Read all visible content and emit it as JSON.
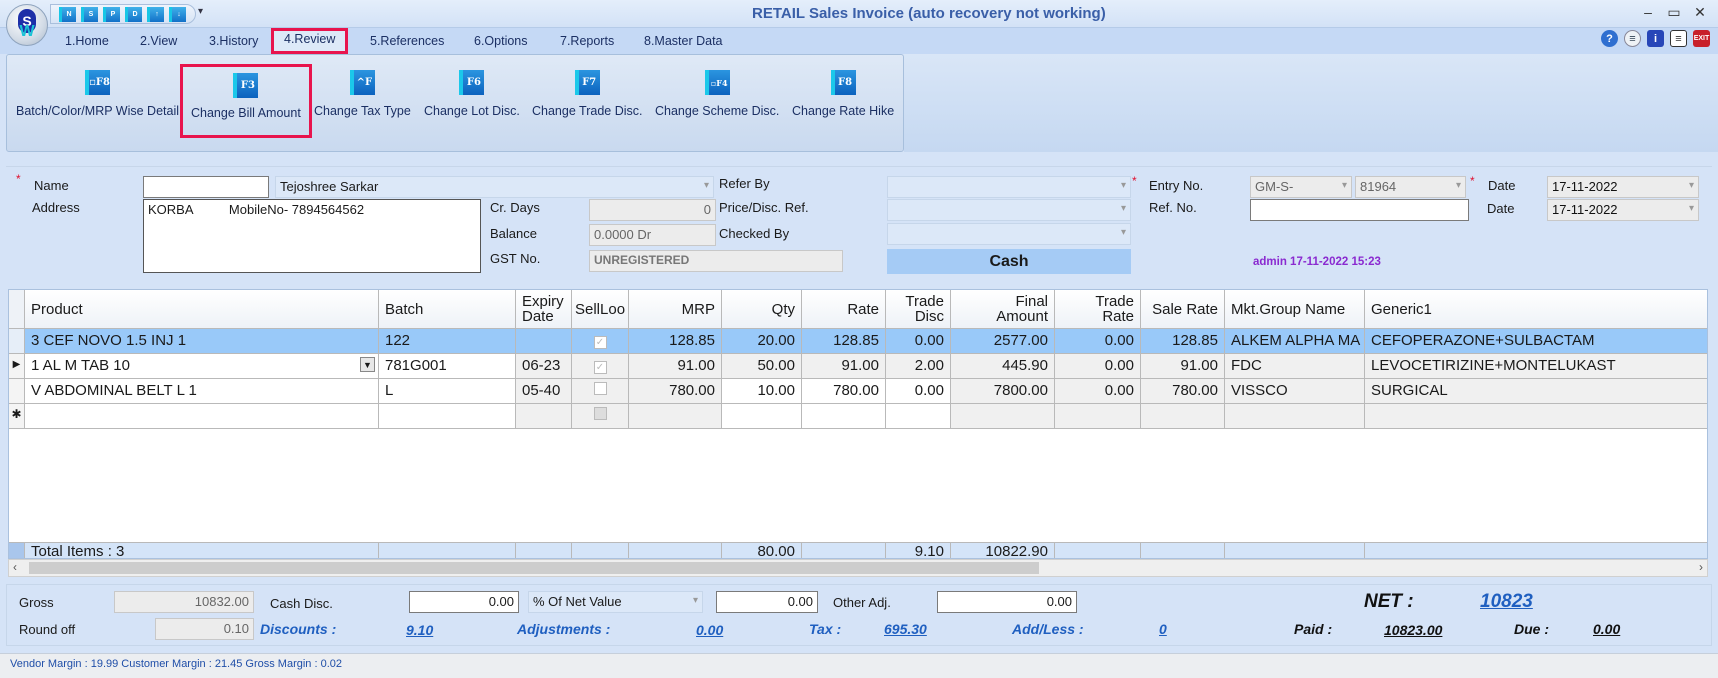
{
  "window": {
    "title": "RETAIL Sales Invoice (auto recovery not working)",
    "controls": {
      "minimize": "–",
      "maximize": "▭",
      "close": "✕"
    }
  },
  "quick_access": [
    {
      "label": "N",
      "icon": "new-icon"
    },
    {
      "label": "S",
      "icon": "save-icon"
    },
    {
      "label": "P",
      "icon": "print-icon"
    },
    {
      "label": "D",
      "icon": "delete-icon"
    },
    {
      "label": "↑",
      "icon": "previous-icon"
    },
    {
      "label": "↓",
      "icon": "next-icon"
    }
  ],
  "menu": {
    "tabs": [
      "1.Home",
      "2.View",
      "3.History",
      "4.Review",
      "5.References",
      "6.Options",
      "7.Reports",
      "8.Master Data"
    ],
    "active": "4.Review"
  },
  "help_icons": [
    "help-icon",
    "chat-icon",
    "info-icon",
    "document-icon",
    "exit-icon"
  ],
  "ribbon": {
    "buttons": [
      {
        "label": "Batch/Color/MRP Wise Detail",
        "key": "▫F8"
      },
      {
        "label": "Change Bill Amount",
        "key": "F3",
        "highlighted": true
      },
      {
        "label": "Change Tax Type",
        "key": "^F"
      },
      {
        "label": "Change Lot Disc.",
        "key": "F6"
      },
      {
        "label": "Change Trade Disc.",
        "key": "F7"
      },
      {
        "label": "Change Scheme Disc.",
        "key": "▫F4"
      },
      {
        "label": "Change Rate Hike",
        "key": "F8"
      }
    ]
  },
  "form": {
    "name_label": "Name",
    "name_code": "",
    "name_value": "Tejoshree Sarkar",
    "address_label": "Address",
    "address_value": "KORBA          MobileNo- 7894564562",
    "cr_days_label": "Cr. Days",
    "cr_days_value": "0",
    "balance_label": "Balance",
    "balance_value": "0.0000 Dr",
    "gst_label": "GST No.",
    "gst_value": "UNREGISTERED",
    "refer_by_label": "Refer By",
    "refer_by_value": "",
    "price_disc_label": "Price/Disc. Ref.",
    "price_disc_value": "",
    "checked_by_label": "Checked By",
    "checked_by_value": "",
    "payment_mode": "Cash",
    "entry_no_label": "Entry No.",
    "entry_series": "GM-S-",
    "entry_no": "81964",
    "ref_no_label": "Ref. No.",
    "ref_no_value": "",
    "date_label": "Date",
    "date_value": "17-11-2022",
    "ref_date_label": "Date",
    "ref_date_value": "17-11-2022",
    "admin_stamp": "admin 17-11-2022 15:23",
    "required_mark": "*"
  },
  "grid": {
    "columns": [
      "Product",
      "Batch",
      "Expiry Date",
      "SellLoo",
      "MRP",
      "Qty",
      "Rate",
      "Trade Disc",
      "Final Amount",
      "Trade Rate",
      "Sale Rate",
      "Mkt.Group Name",
      "Generic1"
    ],
    "rows": [
      {
        "indicator": "",
        "product": "3 CEF NOVO 1.5 INJ 1",
        "batch": "122",
        "expiry": "",
        "sell_loose": true,
        "mrp": "128.85",
        "qty": "20.00",
        "rate": "128.85",
        "trade_disc": "0.00",
        "final_amount": "2577.00",
        "trade_rate": "0.00",
        "sale_rate": "128.85",
        "mkt_group": "ALKEM ALPHA MA",
        "generic": "CEFOPERAZONE+SULBACTAM"
      },
      {
        "indicator": "▶",
        "product": "1 AL M TAB 10",
        "batch": "781G001",
        "expiry": "06-23",
        "sell_loose": true,
        "mrp": "91.00",
        "qty": "50.00",
        "rate": "91.00",
        "trade_disc": "2.00",
        "final_amount": "445.90",
        "trade_rate": "0.00",
        "sale_rate": "91.00",
        "mkt_group": "FDC",
        "generic": "LEVOCETIRIZINE+MONTELUKAST"
      },
      {
        "indicator": "",
        "product": "V ABDOMINAL BELT L 1",
        "batch": "L",
        "expiry": "05-40",
        "sell_loose": false,
        "mrp": "780.00",
        "qty": "10.00",
        "rate": "780.00",
        "trade_disc": "0.00",
        "final_amount": "7800.00",
        "trade_rate": "0.00",
        "sale_rate": "780.00",
        "mkt_group": "VISSCO",
        "generic": "SURGICAL"
      }
    ],
    "new_row_indicator": "✱",
    "totals": {
      "label": "Total Items : 3",
      "qty": "80.00",
      "trade_disc": "9.10",
      "final_amount": "10822.90"
    }
  },
  "footer": {
    "gross_label": "Gross",
    "gross_value": "10832.00",
    "round_off_label": "Round off",
    "round_off_value": "0.10",
    "cash_disc_label": "Cash Disc.",
    "cash_disc_value": "0.00",
    "cash_disc_type": "% Of Net Value",
    "cash_disc_amount": "0.00",
    "other_adj_label": "Other Adj.",
    "other_adj_value": "0.00",
    "discounts_label": "Discounts :",
    "discounts_value": "9.10",
    "adjustments_label": "Adjustments :",
    "adjustments_value": "0.00",
    "tax_label": "Tax :",
    "tax_value": "695.30",
    "addless_label": "Add/Less :",
    "addless_value": "0",
    "net_label": "NET :",
    "net_value": "10823",
    "paid_label": "Paid :",
    "paid_value": "10823.00",
    "due_label": "Due :",
    "due_value": "0.00"
  },
  "status": {
    "text": "Vendor Margin : 19.99 Customer Margin : 21.45 Gross Margin : 0.02"
  }
}
